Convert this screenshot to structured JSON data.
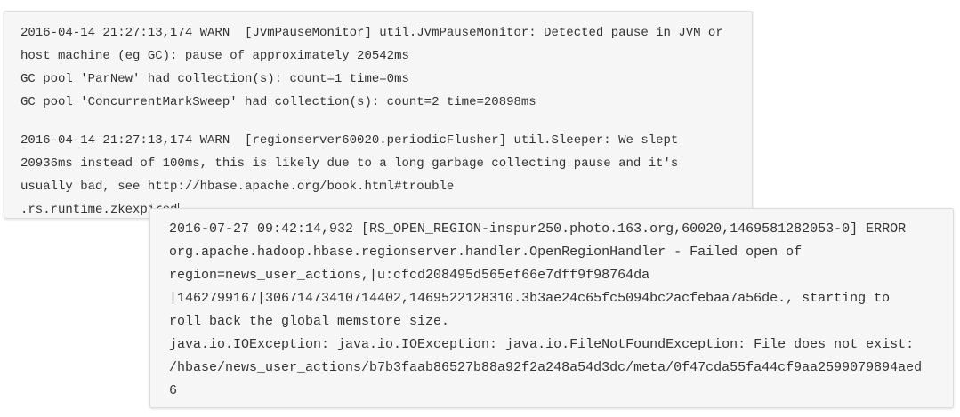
{
  "log_block_1": {
    "lines": [
      "2016-04-14 21:27:13,174 WARN  [JvmPauseMonitor] util.JvmPauseMonitor: Detected pause in JVM or",
      "host machine (eg GC): pause of approximately 20542ms",
      "GC pool 'ParNew' had collection(s): count=1 time=0ms",
      "GC pool 'ConcurrentMarkSweep' had collection(s): count=2 time=20898ms",
      "2016-04-14 21:27:13,174 WARN  [regionserver60020.periodicFlusher] util.Sleeper: We slept",
      "20936ms instead of 100ms, this is likely due to a long garbage collecting pause and it's",
      "usually bad, see http://hbase.apache.org/book.html#trouble",
      ".rs.runtime.zkexpired"
    ]
  },
  "log_block_2": {
    "lines": [
      "2016-07-27 09:42:14,932 [RS_OPEN_REGION-inspur250.photo.163.org,60020,1469581282053-0] ERROR",
      "org.apache.hadoop.hbase.regionserver.handler.OpenRegionHandler - Failed open of",
      "region=news_user_actions,|u:cfcd208495d565ef66e7dff9f98764da",
      "|1462799167|30671473410714402,1469522128310.3b3ae24c65fc5094bc2acfebaa7a56de., starting to",
      "roll back the global memstore size.",
      "java.io.IOException: java.io.IOException: java.io.FileNotFoundException: File does not exist:",
      "/hbase/news_user_actions/b7b3faab86527b88a92f2a248a54d3dc/meta/0f47cda55fa44cf9aa2599079894aed",
      "6"
    ]
  }
}
